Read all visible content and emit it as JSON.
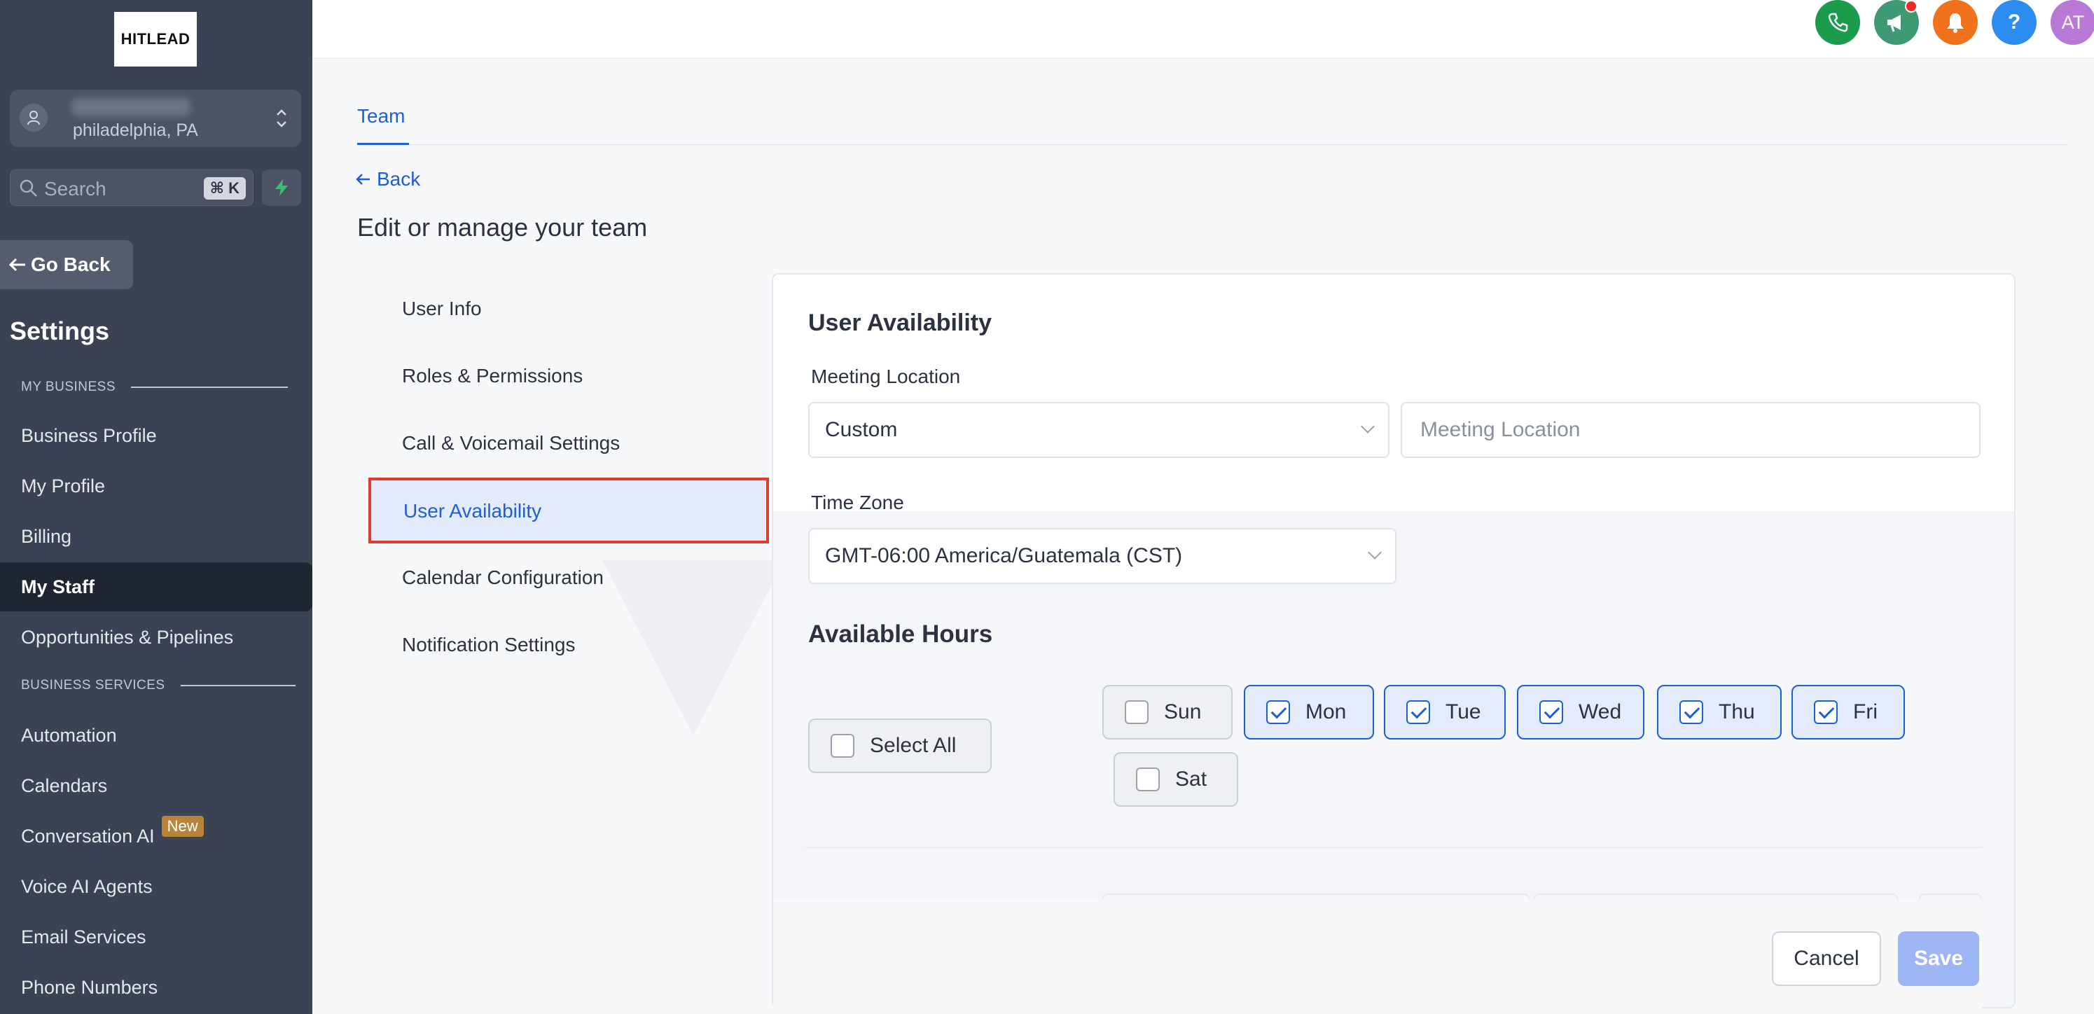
{
  "brand": {
    "logo_text": "HITLEAD"
  },
  "account": {
    "location": "philadelphia, PA"
  },
  "search": {
    "placeholder": "Search",
    "shortcut": "⌘ K"
  },
  "sidebar": {
    "go_back": "Go Back",
    "title": "Settings",
    "section_my_business": "MY BUSINESS",
    "section_business_services": "BUSINESS SERVICES",
    "items": [
      {
        "label": "Business Profile"
      },
      {
        "label": "My Profile"
      },
      {
        "label": "Billing"
      },
      {
        "label": "My Staff",
        "active": true
      },
      {
        "label": "Opportunities & Pipelines"
      },
      {
        "label": "Automation"
      },
      {
        "label": "Calendars"
      },
      {
        "label": "Conversation AI",
        "badge": "New"
      },
      {
        "label": "Voice AI Agents"
      },
      {
        "label": "Email Services"
      },
      {
        "label": "Phone Numbers"
      }
    ]
  },
  "topbar": {
    "icons": [
      {
        "name": "phone-icon",
        "color": "#1a9a4b"
      },
      {
        "name": "megaphone-icon",
        "color": "#3d9a72"
      },
      {
        "name": "bell-icon",
        "color": "#f2711c"
      },
      {
        "name": "help-icon",
        "color": "#2d8cf0",
        "glyph": "?"
      },
      {
        "name": "avatar",
        "color": "#b87ad6",
        "glyph": "AT"
      }
    ]
  },
  "main": {
    "tab": "Team",
    "back": "Back",
    "title": "Edit or manage your team",
    "subnav": [
      "User Info",
      "Roles & Permissions",
      "Call & Voicemail Settings",
      "User Availability",
      "Calendar Configuration",
      "Notification Settings"
    ],
    "active_subnav": "User Availability"
  },
  "card": {
    "title": "User Availability",
    "meeting_location_label": "Meeting Location",
    "meeting_location_select": "Custom",
    "meeting_location_placeholder": "Meeting Location",
    "time_zone_label": "Time Zone",
    "time_zone_value": "GMT-06:00 America/Guatemala (CST)",
    "available_hours_title": "Available Hours",
    "select_all": "Select All",
    "days": [
      {
        "label": "Sun",
        "checked": false
      },
      {
        "label": "Mon",
        "checked": true
      },
      {
        "label": "Tue",
        "checked": true
      },
      {
        "label": "Wed",
        "checked": true
      },
      {
        "label": "Thu",
        "checked": true
      },
      {
        "label": "Fri",
        "checked": true
      },
      {
        "label": "Sat",
        "checked": false
      }
    ]
  },
  "actions": {
    "cancel": "Cancel",
    "save": "Save"
  }
}
